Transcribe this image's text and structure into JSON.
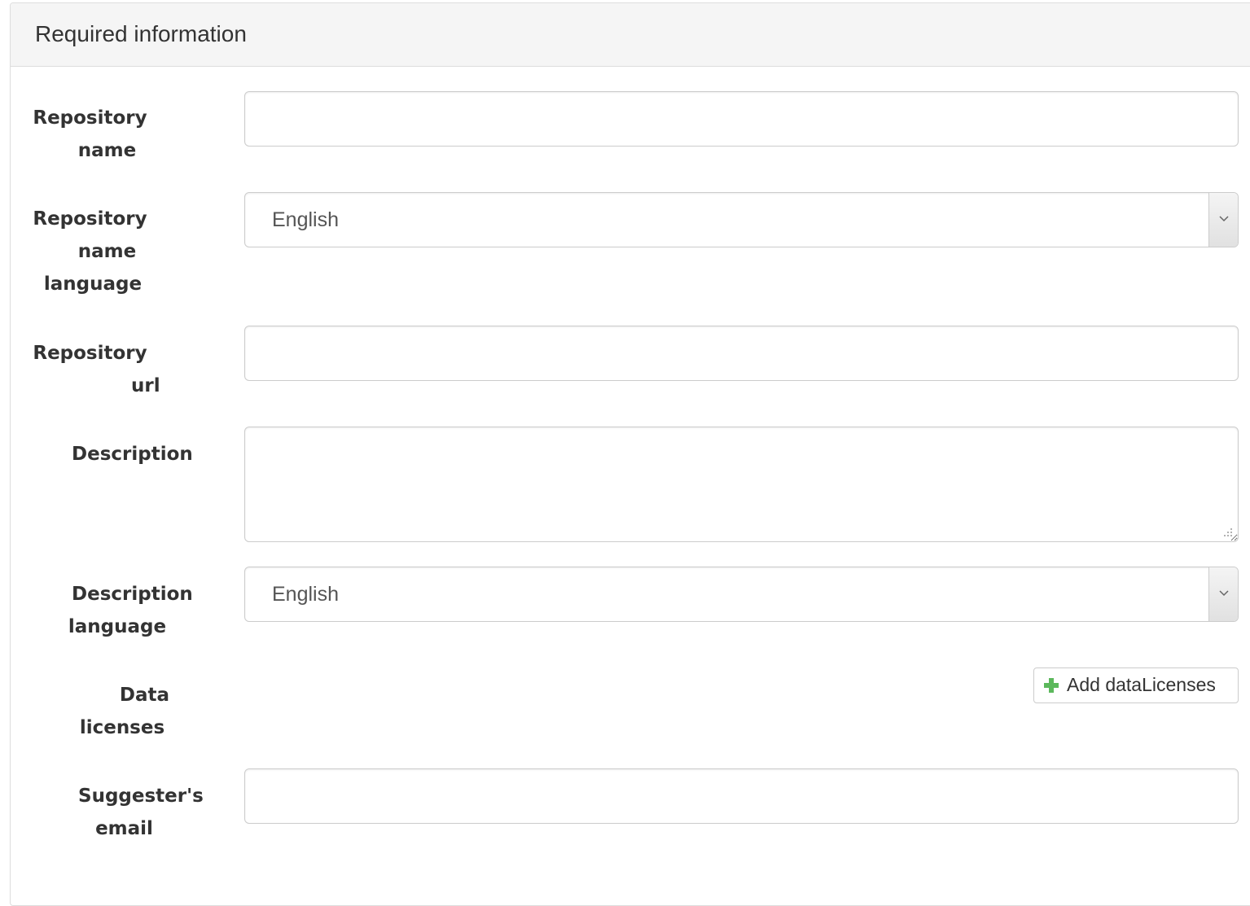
{
  "panel": {
    "title": "Required information"
  },
  "form": {
    "repository_name": {
      "label_lines": [
        "Repository",
        "name"
      ],
      "value": "",
      "placeholder": ""
    },
    "repository_name_language": {
      "label_lines": [
        "Repository",
        "name",
        "language"
      ],
      "selected": "English"
    },
    "repository_url": {
      "label_lines": [
        "Repository",
        "url"
      ],
      "value": "",
      "placeholder": ""
    },
    "description": {
      "label_lines": [
        "Description"
      ],
      "value": "",
      "placeholder": ""
    },
    "description_language": {
      "label_lines": [
        "Description",
        "language"
      ],
      "selected": "English"
    },
    "data_licenses": {
      "label_lines": [
        "Data",
        "licenses"
      ],
      "add_button_label": "Add dataLicenses",
      "add_icon": "plus-icon"
    },
    "suggester_email": {
      "label_lines": [
        "Suggester's",
        "email"
      ],
      "value": "",
      "placeholder": ""
    }
  },
  "icons": {
    "select_arrow": "chevron-down-icon",
    "resize_grip": "resize-grip-icon"
  },
  "colors": {
    "heading_background": "#f5f5f5",
    "border": "#cccccc",
    "plus_icon": "#5cb85c",
    "text": "#333333"
  }
}
